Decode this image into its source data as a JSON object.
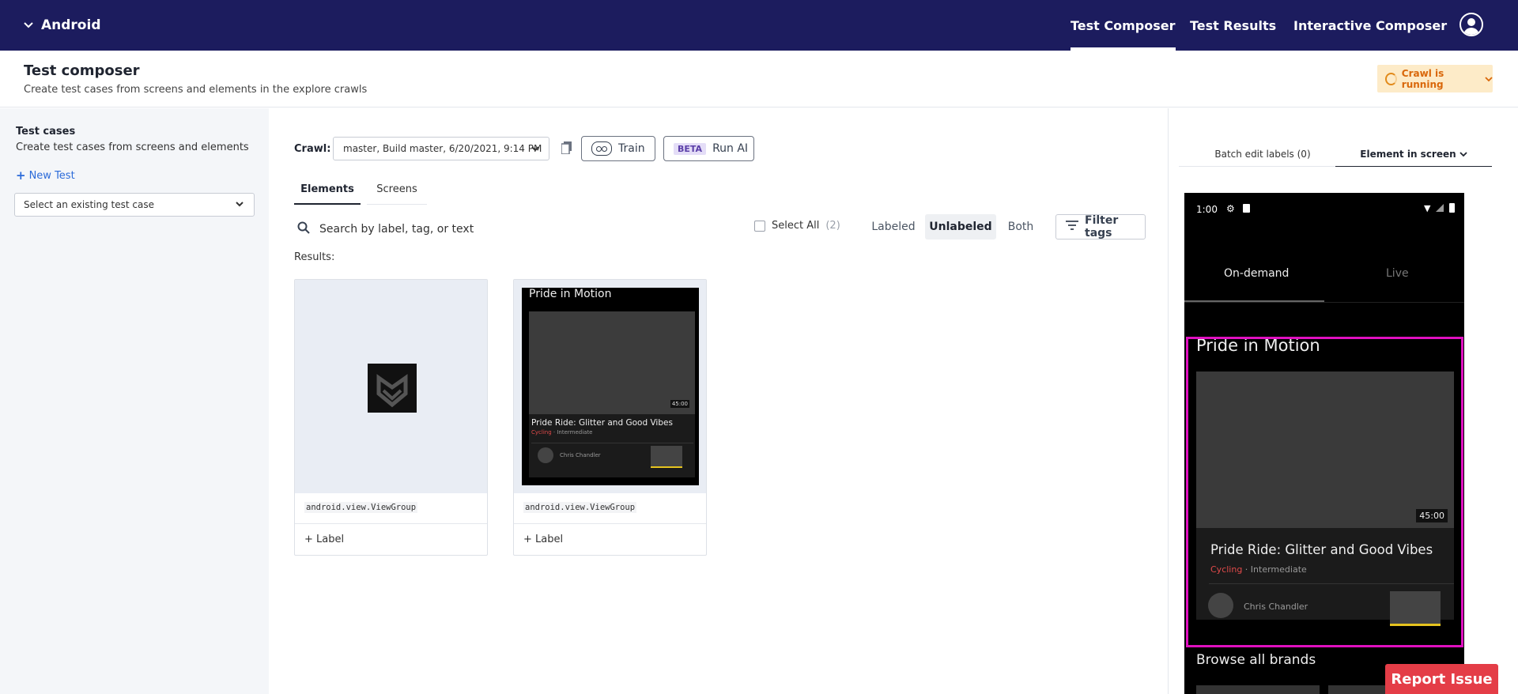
{
  "nav": {
    "app_name": "Android",
    "tabs": [
      "Test Composer",
      "Test Results",
      "Interactive Composer"
    ],
    "active_tab": "Test Composer"
  },
  "header": {
    "title": "Test composer",
    "subtitle": "Create test cases from screens and elements in the explore crawls",
    "crawl_status": "Crawl is running"
  },
  "sidebar": {
    "title": "Test cases",
    "description": "Create test cases from screens and elements",
    "new_test": "New Test",
    "select_placeholder": "Select an existing test case"
  },
  "main": {
    "crawl_label": "Crawl:",
    "crawl_value": "master, Build master, 6/20/2021, 9:14 PM",
    "train_label": "Train",
    "beta_badge": "BETA",
    "run_ai_label": "Run AI",
    "tabs": [
      "Elements",
      "Screens"
    ],
    "search_placeholder": "Search by label, tag, or text",
    "select_all": "Select All",
    "select_count": "(2)",
    "filters": [
      "Labeled",
      "Unlabeled",
      "Both"
    ],
    "active_filter": "Unlabeled",
    "filter_tags": "Filter tags",
    "results_label": "Results:",
    "cards": [
      {
        "class_name": "android.view.ViewGroup",
        "label_action": "+ Label"
      },
      {
        "class_name": "android.view.ViewGroup",
        "label_action": "+ Label",
        "preview": {
          "section": "Pride in Motion",
          "duration": "45:00",
          "title": "Pride Ride: Glitter and Good Vibes",
          "category": "Cycling",
          "level": " · Intermediate",
          "instructor": "Chris Chandler"
        }
      }
    ]
  },
  "right_panel": {
    "tabs": [
      "Batch edit labels (0)",
      "Element in screen"
    ],
    "phone": {
      "time": "1:00",
      "tabs": [
        "On-demand",
        "Live"
      ],
      "section": "Pride in Motion",
      "duration": "45:00",
      "title": "Pride Ride: Glitter and Good Vibes",
      "category": "Cycling",
      "level": " · Intermediate",
      "instructor": "Chris Chandler",
      "browse": "Browse all brands"
    }
  },
  "report_issue": "Report Issue",
  "colors": {
    "nav_bg": "#1c1c5e",
    "highlight": "#e010c0",
    "report": "#e43d47",
    "crawl_status_bg": "#fdebc8",
    "link": "#2c6bd9"
  }
}
